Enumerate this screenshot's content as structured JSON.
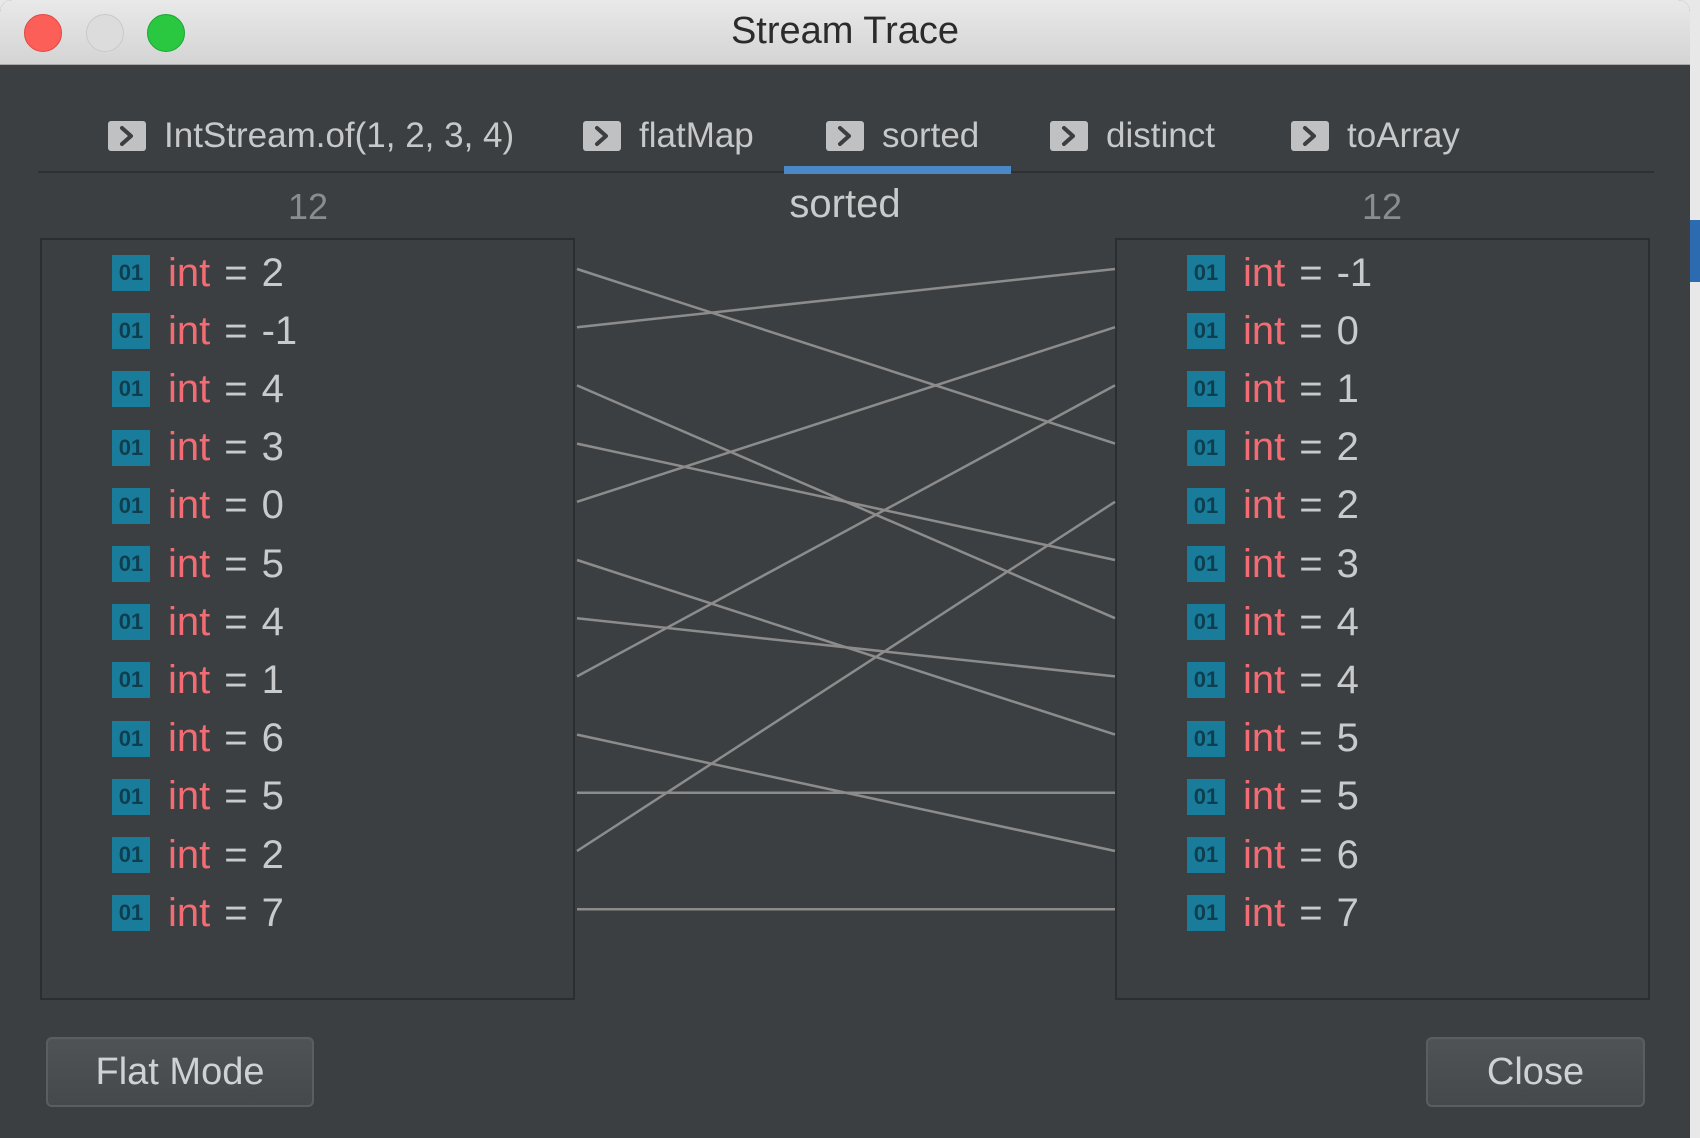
{
  "window": {
    "title": "Stream Trace"
  },
  "tabs": [
    {
      "label": "IntStream.of(1, 2, 3, 4)",
      "icon": "chevron-right-icon"
    },
    {
      "label": "flatMap",
      "icon": "chevron-right-icon"
    },
    {
      "label": "sorted",
      "icon": "chevron-right-icon",
      "selected": true
    },
    {
      "label": "distinct",
      "icon": "chevron-right-icon"
    },
    {
      "label": "toArray",
      "icon": "chevron-right-icon"
    }
  ],
  "operation": "sorted",
  "before": {
    "count": "12",
    "items": [
      {
        "type": "int",
        "value": "2"
      },
      {
        "type": "int",
        "value": "-1"
      },
      {
        "type": "int",
        "value": "4"
      },
      {
        "type": "int",
        "value": "3"
      },
      {
        "type": "int",
        "value": "0"
      },
      {
        "type": "int",
        "value": "5"
      },
      {
        "type": "int",
        "value": "4"
      },
      {
        "type": "int",
        "value": "1"
      },
      {
        "type": "int",
        "value": "6"
      },
      {
        "type": "int",
        "value": "5"
      },
      {
        "type": "int",
        "value": "2"
      },
      {
        "type": "int",
        "value": "7"
      }
    ]
  },
  "after": {
    "count": "12",
    "items": [
      {
        "type": "int",
        "value": "-1"
      },
      {
        "type": "int",
        "value": "0"
      },
      {
        "type": "int",
        "value": "1"
      },
      {
        "type": "int",
        "value": "2"
      },
      {
        "type": "int",
        "value": "2"
      },
      {
        "type": "int",
        "value": "3"
      },
      {
        "type": "int",
        "value": "4"
      },
      {
        "type": "int",
        "value": "4"
      },
      {
        "type": "int",
        "value": "5"
      },
      {
        "type": "int",
        "value": "5"
      },
      {
        "type": "int",
        "value": "6"
      },
      {
        "type": "int",
        "value": "7"
      }
    ]
  },
  "badge_text": "01",
  "mappings": [
    [
      0,
      3
    ],
    [
      1,
      0
    ],
    [
      2,
      6
    ],
    [
      3,
      5
    ],
    [
      4,
      1
    ],
    [
      5,
      8
    ],
    [
      6,
      7
    ],
    [
      7,
      2
    ],
    [
      8,
      10
    ],
    [
      9,
      9
    ],
    [
      10,
      4
    ],
    [
      11,
      11
    ]
  ],
  "buttons": {
    "flat_mode": "Flat Mode",
    "close": "Close"
  },
  "colors": {
    "accent": "#4a88c7",
    "type_keyword": "#f36b73",
    "badge": "#197c9b",
    "link_line": "#8c8c8c",
    "background": "#3c3f41"
  }
}
